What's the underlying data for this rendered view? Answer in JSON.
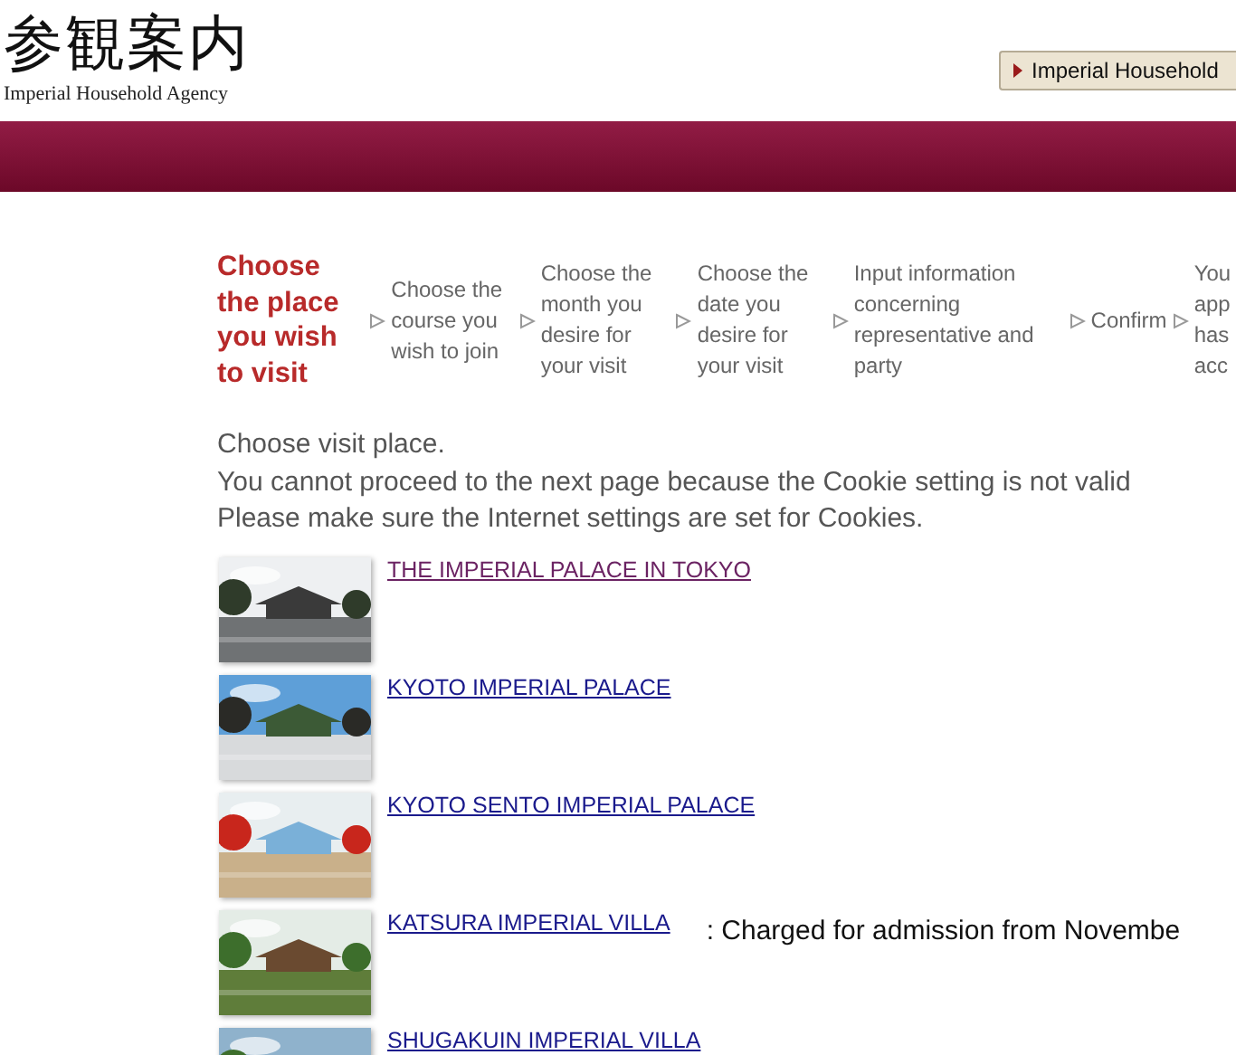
{
  "header": {
    "logo_title": "参観案内",
    "logo_subtitle": "Imperial Household Agency",
    "agency_link": "Imperial Household"
  },
  "steps": [
    {
      "label": "Choose the place you wish to visit",
      "selected": true
    },
    {
      "label": "Choose the course you wish to join",
      "selected": false
    },
    {
      "label": "Choose the month you desire for your visit",
      "selected": false
    },
    {
      "label": "Choose the date you desire for your visit",
      "selected": false
    },
    {
      "label": "Input information concerning representative and party",
      "selected": false
    },
    {
      "label": "Confirm",
      "selected": false
    },
    {
      "label": "You app has acc",
      "selected": false
    }
  ],
  "intro": [
    "Choose visit place.",
    "You cannot proceed to the next page because the Cookie setting is not valid",
    "Please make sure the Internet settings are set for Cookies."
  ],
  "places": [
    {
      "name": "THE IMPERIAL PALACE IN TOKYO",
      "visited": true
    },
    {
      "name": "KYOTO IMPERIAL PALACE",
      "visited": false
    },
    {
      "name": "KYOTO SENTO IMPERIAL PALACE",
      "visited": false
    },
    {
      "name": "KATSURA IMPERIAL VILLA",
      "visited": false,
      "note": ": Charged for admission from Novembe"
    },
    {
      "name": "SHUGAKUIN IMPERIAL VILLA",
      "visited": false
    }
  ]
}
